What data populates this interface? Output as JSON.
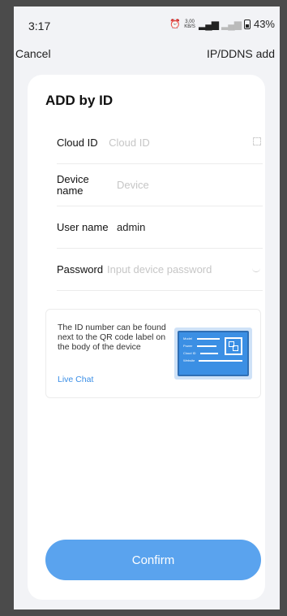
{
  "status_bar": {
    "time": "3:17",
    "net_speed": "3.00 KB/S",
    "signal_text": "4G",
    "battery_percent": "43%"
  },
  "nav": {
    "left_label": "Cancel",
    "right_label": "IP/DDNS add"
  },
  "form": {
    "title": "ADD by ID",
    "fields": [
      {
        "label": "Cloud ID",
        "value": "",
        "placeholder": "Cloud ID"
      },
      {
        "label": "Device name",
        "value": "",
        "placeholder": "Device"
      },
      {
        "label": "User name",
        "value": "admin",
        "placeholder": ""
      },
      {
        "label": "Password",
        "value": "",
        "placeholder": "Input device password"
      }
    ]
  },
  "info": {
    "text": "The ID number can be found next to the QR code label on the body of the device",
    "link": "Live Chat",
    "label_lines": [
      "Model",
      "Power",
      "Cloud ID",
      "Website"
    ]
  },
  "confirm_label": "Confirm",
  "colors": {
    "accent": "#5aa3ee",
    "link": "#3a8ee6"
  }
}
